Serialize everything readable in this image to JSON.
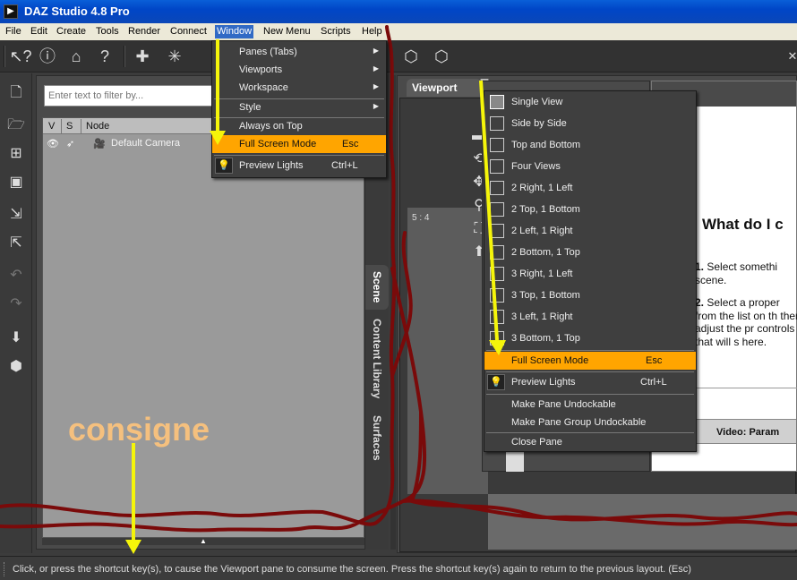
{
  "window": {
    "title": "DAZ Studio 4.8 Pro",
    "app_icon": "daz-logo-icon"
  },
  "menubar": [
    {
      "label": "File"
    },
    {
      "label": "Edit"
    },
    {
      "label": "Create"
    },
    {
      "label": "Tools"
    },
    {
      "label": "Render"
    },
    {
      "label": "Connect"
    },
    {
      "label": "Window",
      "active": true
    },
    {
      "label": "New Menu"
    },
    {
      "label": "Scripts"
    },
    {
      "label": "Help"
    }
  ],
  "toolbar": {
    "icons": [
      "whats-this-icon",
      "help-icon",
      "home-icon",
      "help-icon",
      "camera-add-icon",
      "spotlight-icon",
      "distant-light-icon"
    ],
    "right_icons": [
      "cube-icon",
      "cube-icon",
      "pin-icon"
    ]
  },
  "left_tools": [
    "new-icon",
    "open-icon",
    "merge-icon",
    "save-icon",
    "import-icon",
    "export-icon",
    "undo-icon",
    "redo-icon",
    "drop-icon",
    "figure-icon"
  ],
  "scene": {
    "filter_placeholder": "Enter text to filter by...",
    "columns": [
      "V",
      "S",
      "Node"
    ],
    "rows": [
      {
        "node": "Default Camera",
        "icon": "camera-icon"
      }
    ]
  },
  "side_tabs": [
    "Scene",
    "Content Library",
    "Surfaces"
  ],
  "viewport": {
    "tab": "Viewport",
    "ratio": "5 : 4"
  },
  "help_panel": {
    "title": "What do I c",
    "step1_num": "1.",
    "step1": " Select somethi scene.",
    "step2_num": "2.",
    "step2": " Select a proper from the list on th then adjust the pr controls that will s here.",
    "video": "Video: Param"
  },
  "window_menu": {
    "items": [
      {
        "label": "Panes (Tabs)",
        "submenu": true
      },
      {
        "label": "Viewports",
        "submenu": true
      },
      {
        "label": "Workspace",
        "submenu": true
      },
      {
        "label": "Style",
        "submenu": true
      },
      {
        "label": "Always on Top"
      },
      {
        "label": "Full Screen Mode",
        "key": "Esc",
        "highlighted": true
      },
      {
        "label": "Preview Lights",
        "key": "Ctrl+L",
        "icon": "bulb-icon"
      }
    ]
  },
  "viewport_menu": {
    "layouts": [
      "Single View",
      "Side by Side",
      "Top and Bottom",
      "Four Views",
      "2 Right, 1 Left",
      "2 Top, 1 Bottom",
      "2 Left, 1 Right",
      "2 Bottom, 1 Top",
      "3 Right, 1 Left",
      "3 Top, 1 Bottom",
      "3 Left, 1 Right",
      "3 Bottom, 1 Top"
    ],
    "full_screen": {
      "label": "Full Screen Mode",
      "key": "Esc"
    },
    "preview_lights": {
      "label": "Preview Lights",
      "key": "Ctrl+L"
    },
    "undock": "Make Pane Undockable",
    "group_undock": "Make Pane Group Undockable",
    "close": "Close Pane"
  },
  "annotation": {
    "label": "consigne",
    "color": "#f5c07e",
    "arrow_color": "#f5f50a",
    "scribble_color": "#7a0a0a"
  },
  "status": "Click, or press the shortcut key(s), to cause the Viewport pane to consume the screen.  Press the shortcut key(s) again to return to the previous layout. (Esc)",
  "colors": {
    "highlight": "#ffa500",
    "menu_bg": "#3f3f3f",
    "titlebar": "#0046c7"
  }
}
